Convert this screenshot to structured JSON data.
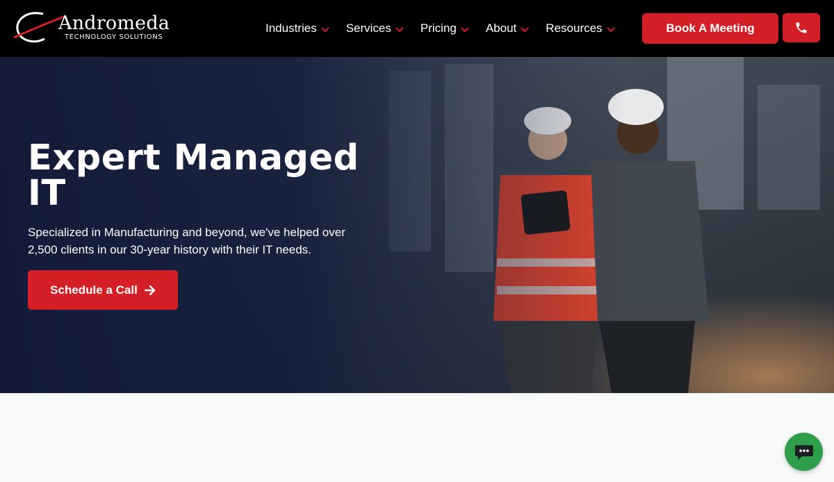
{
  "brand": {
    "name": "Andromeda",
    "tagline": "TECHNOLOGY SOLUTIONS"
  },
  "nav": {
    "items": [
      {
        "label": "Industries",
        "icon": "chevron-down-icon"
      },
      {
        "label": "Services",
        "icon": "chevron-down-icon"
      },
      {
        "label": "Pricing",
        "icon": "chevron-down-icon"
      },
      {
        "label": "About",
        "icon": "chevron-down-icon"
      },
      {
        "label": "Resources",
        "icon": "chevron-down-icon"
      }
    ],
    "cta_label": "Book A Meeting",
    "phone_icon": "phone-icon"
  },
  "hero": {
    "title": "Expert Managed IT",
    "subtitle": "Specialized in Manufacturing and beyond, we've helped over 2,500 clients in our 30-year history with their IT needs.",
    "button_label": "Schedule a Call",
    "button_icon": "arrow-right-icon"
  },
  "chat": {
    "icon": "chat-icon"
  },
  "colors": {
    "accent": "#d41f26",
    "header_bg": "#000000",
    "hero_overlay": "#101836",
    "chat": "#2f9e4a"
  }
}
